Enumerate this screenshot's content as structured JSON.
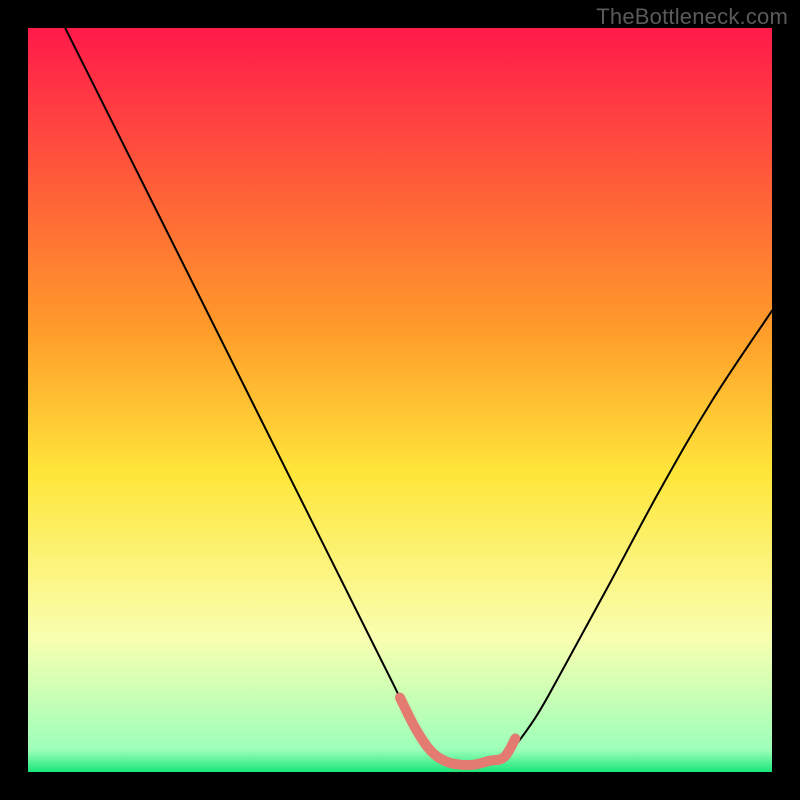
{
  "watermark": "TheBottleneck.com",
  "chart_data": {
    "type": "line",
    "title": "",
    "xlabel": "",
    "ylabel": "",
    "xlim": [
      0,
      100
    ],
    "ylim": [
      0,
      100
    ],
    "legend": false,
    "grid": false,
    "background_gradient": [
      {
        "pos": 0.0,
        "color": "#ff1a4a"
      },
      {
        "pos": 0.4,
        "color": "#ff9a2a"
      },
      {
        "pos": 0.6,
        "color": "#ffe63a"
      },
      {
        "pos": 0.82,
        "color": "#f9ffb0"
      },
      {
        "pos": 0.97,
        "color": "#9dffb9"
      },
      {
        "pos": 1.0,
        "color": "#19e67a"
      }
    ],
    "series": [
      {
        "name": "curve",
        "stroke": "#000000",
        "stroke_width": 2,
        "x": [
          5,
          9,
          14,
          20,
          26,
          32,
          38,
          44,
          49,
          52,
          55,
          58,
          61,
          64,
          68,
          72,
          78,
          85,
          92,
          100
        ],
        "values": [
          100,
          92,
          82,
          70,
          58,
          46,
          34,
          22,
          12,
          6,
          2,
          1,
          1,
          2,
          7,
          14,
          25,
          38,
          50,
          62
        ]
      },
      {
        "name": "trough-highlight",
        "stroke": "#e47b70",
        "stroke_width": 10,
        "x": [
          50,
          52,
          54,
          56,
          58,
          60,
          62,
          64,
          65.5
        ],
        "values": [
          10,
          6,
          3,
          1.5,
          1,
          1,
          1.5,
          2,
          4.5
        ]
      }
    ]
  }
}
